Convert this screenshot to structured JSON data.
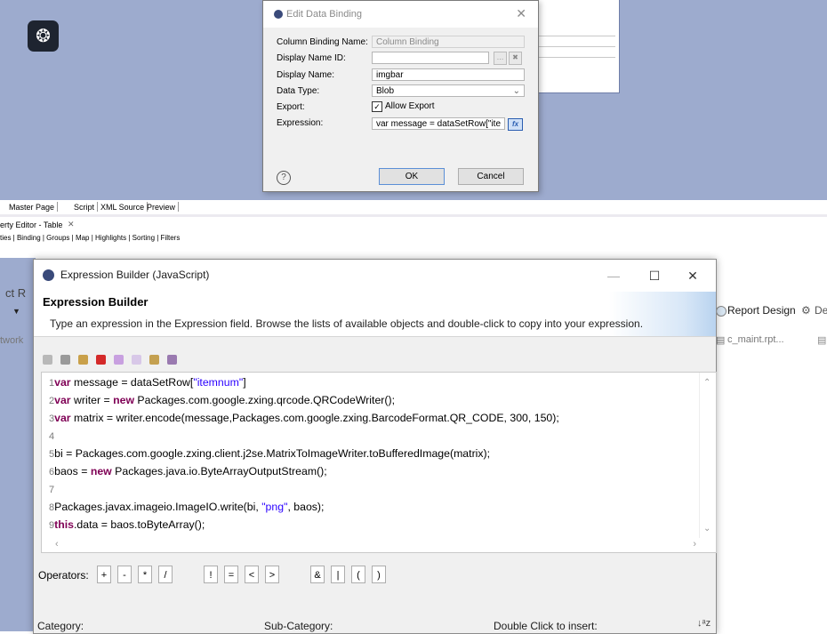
{
  "edit_binding": {
    "title": "Edit Data Binding",
    "close": "✕",
    "labels": [
      "Column Binding Name:",
      "Display Name ID:",
      "Display Name:",
      "Data Type:",
      "Export:",
      "Expression:"
    ],
    "column_binding_name": "Column Binding",
    "display_name_id": "",
    "display_name": "imgbar",
    "data_type": "Blob",
    "allow_export_label": "Allow Export",
    "expression": "var message = dataSetRow[\"ite",
    "ok": "OK",
    "cancel": "Cancel",
    "help": "?"
  },
  "editor_tabs": [
    "Master Page",
    "Script",
    "XML Source",
    "Preview"
  ],
  "property_editor": {
    "title": "erty Editor - Table",
    "close": "✕",
    "tabs": "ties | Binding | Groups | Map | Highlights | Sorting | Filters"
  },
  "background": {
    "left_partial": "ct  R",
    "workspace_partial": "twork",
    "report_design": "Report Design",
    "next_perspective": "De",
    "file_tab": "c_maint.rpt..."
  },
  "expression_builder": {
    "window_title": "Expression Builder (JavaScript)",
    "minimize": "—",
    "maximize": "☐",
    "close": "✕",
    "heading": "Expression Builder",
    "description": "Type an expression in the Expression field. Browse the lists of available objects and double-click to copy into your expression.",
    "code": [
      {
        "n": "1",
        "parts": [
          {
            "t": "var",
            "k": "kw"
          },
          {
            "t": " message = dataSetRow[",
            "k": ""
          },
          {
            "t": "\"itemnum\"",
            "k": "str"
          },
          {
            "t": "]",
            "k": ""
          }
        ]
      },
      {
        "n": "2",
        "parts": [
          {
            "t": "var",
            "k": "kw"
          },
          {
            "t": " writer = ",
            "k": ""
          },
          {
            "t": "new",
            "k": "kw"
          },
          {
            "t": " Packages.com.google.zxing.qrcode.QRCodeWriter();",
            "k": ""
          }
        ]
      },
      {
        "n": "3",
        "parts": [
          {
            "t": "var",
            "k": "kw"
          },
          {
            "t": " matrix = writer.encode(message,Packages.com.google.zxing.BarcodeFormat.QR_CODE, 300, 150);",
            "k": ""
          }
        ]
      },
      {
        "n": "4",
        "parts": []
      },
      {
        "n": "5",
        "parts": [
          {
            "t": "bi = Packages.com.google.zxing.client.j2se.MatrixToImageWriter.toBufferedImage(matrix);",
            "k": ""
          }
        ]
      },
      {
        "n": "6",
        "parts": [
          {
            "t": "baos = ",
            "k": ""
          },
          {
            "t": "new",
            "k": "kw"
          },
          {
            "t": " Packages.java.io.ByteArrayOutputStream();",
            "k": ""
          }
        ]
      },
      {
        "n": "7",
        "parts": []
      },
      {
        "n": "8",
        "parts": [
          {
            "t": "Packages.javax.imageio.ImageIO.write(bi, ",
            "k": ""
          },
          {
            "t": "\"png\"",
            "k": "str"
          },
          {
            "t": ", baos);",
            "k": ""
          }
        ]
      },
      {
        "n": "9",
        "parts": [
          {
            "t": "this",
            "k": "kw"
          },
          {
            "t": ".data = baos.toByteArray();",
            "k": ""
          }
        ]
      }
    ],
    "operators_label": "Operators:",
    "operators": [
      "+",
      "-",
      "*",
      "/",
      "!",
      "=",
      "<",
      ">",
      "&",
      "|",
      "(",
      ")"
    ],
    "category_label": "Category:",
    "subcategory_label": "Sub-Category:",
    "double_click_label": "Double Click to insert:"
  }
}
